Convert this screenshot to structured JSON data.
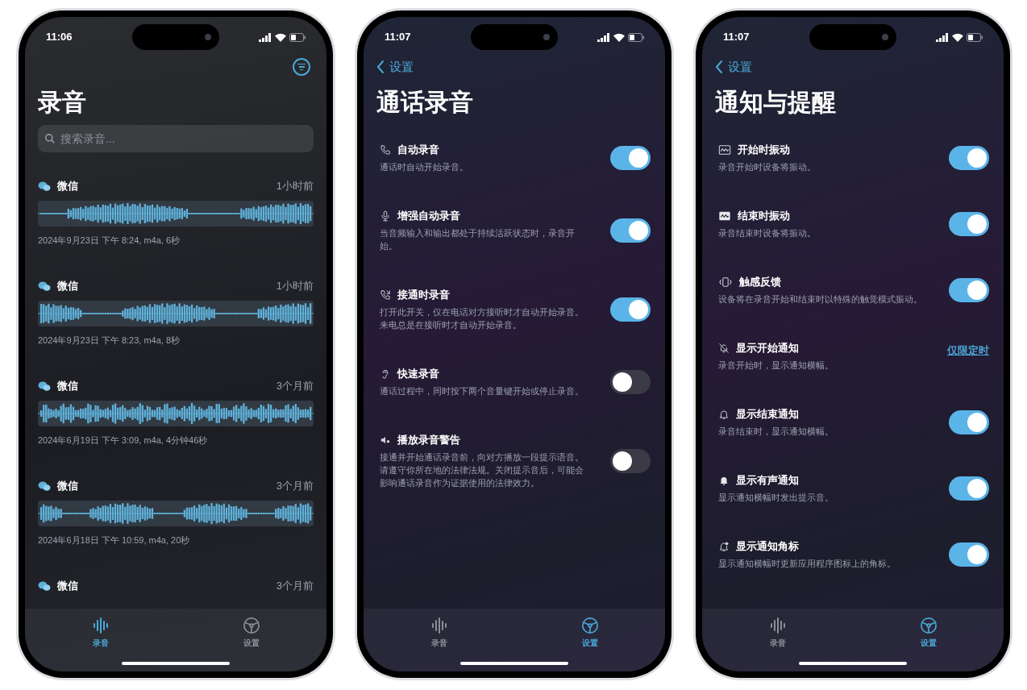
{
  "phones": [
    {
      "kind": "recordings",
      "status_bar": {
        "time": "11:06"
      },
      "title": "录音",
      "search": {
        "placeholder": "搜索录音..."
      },
      "recordings": [
        {
          "source": "微信",
          "age": "1小时前",
          "details": "2024年9月23日 下午 8:24, m4a, 6秒"
        },
        {
          "source": "微信",
          "age": "1小时前",
          "details": "2024年9月23日 下午 8:23, m4a, 8秒"
        },
        {
          "source": "微信",
          "age": "3个月前",
          "details": "2024年6月19日 下午 3:09, m4a, 4分钟46秒"
        },
        {
          "source": "微信",
          "age": "3个月前",
          "details": "2024年6月18日 下午 10:59, m4a, 20秒"
        },
        {
          "source": "微信",
          "age": "3个月前"
        }
      ],
      "tab_bar": [
        {
          "label": "录音",
          "selected": true
        },
        {
          "label": "设置",
          "selected": false
        }
      ]
    },
    {
      "kind": "settings",
      "status_bar": {
        "time": "11:07"
      },
      "back": "设置",
      "title": "通话录音",
      "settings": [
        {
          "kind": "toggle",
          "title": "自动录音",
          "description": "通话时自动开始录音。",
          "on": true
        },
        {
          "kind": "toggle",
          "title": "增强自动录音",
          "description": "当音频输入和输出都处于持续活跃状态时，录音开始。",
          "on": true
        },
        {
          "kind": "toggle",
          "title": "接通时录音",
          "description": "打开此开关，仅在电话对方接听时才自动开始录音。来电总是在接听时才自动开始录音。",
          "on": true
        },
        {
          "kind": "toggle",
          "title": "快速录音",
          "description": "通话过程中，同时按下两个音量键开始或停止录音。",
          "on": false
        },
        {
          "kind": "toggle",
          "title": "播放录音警告",
          "description": "接通并开始通话录音前，向对方播放一段提示语音。请遵守你所在地的法律法规。关闭提示音后，可能会影响通话录音作为证据使用的法律效力。",
          "on": false
        }
      ],
      "tab_bar": [
        {
          "label": "录音",
          "selected": false
        },
        {
          "label": "设置",
          "selected": true
        }
      ]
    },
    {
      "kind": "settings",
      "status_bar": {
        "time": "11:07"
      },
      "back": "设置",
      "title": "通知与提醒",
      "settings": [
        {
          "kind": "toggle",
          "title": "开始时振动",
          "description": "录音开始时设备将振动。",
          "on": true
        },
        {
          "kind": "toggle",
          "title": "结束时振动",
          "description": "录音结束时设备将振动。",
          "on": true
        },
        {
          "kind": "toggle",
          "title": "触感反馈",
          "description": "设备将在录音开始和结束时以特殊的触觉模式振动。",
          "on": true
        },
        {
          "kind": "link",
          "title": "显示开始通知",
          "description": "录音开始时，显示通知横幅。",
          "value": "仅限定时"
        },
        {
          "kind": "toggle",
          "title": "显示结束通知",
          "description": "录音结束时，显示通知横幅。",
          "on": true
        },
        {
          "kind": "toggle",
          "title": "显示有声通知",
          "description": "显示通知横幅时发出提示音。",
          "on": true
        },
        {
          "kind": "toggle",
          "title": "显示通知角标",
          "description": "显示通知横幅时更新应用程序图标上的角标。",
          "on": true
        }
      ],
      "tab_bar": [
        {
          "label": "录音",
          "selected": false
        },
        {
          "label": "设置",
          "selected": true
        }
      ]
    }
  ]
}
